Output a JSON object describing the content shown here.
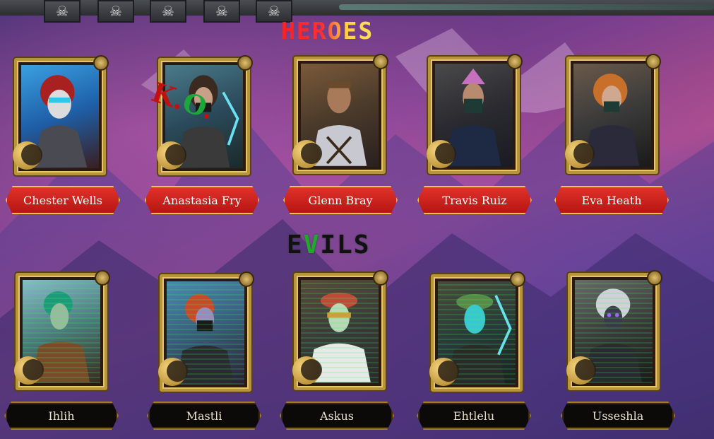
{
  "sections": {
    "heroes_title": "HEROES",
    "evils_title_parts": [
      "E",
      "V",
      "ILS"
    ]
  },
  "heroes": [
    {
      "name": "Chester Wells",
      "status": ""
    },
    {
      "name": "Anastasia Fry",
      "status": "K.O."
    },
    {
      "name": "Glenn Bray",
      "status": ""
    },
    {
      "name": "Travis Ruiz",
      "status": ""
    },
    {
      "name": "Eva Heath",
      "status": ""
    }
  ],
  "ko_parts": [
    "K",
    ".",
    "O",
    "."
  ],
  "evils": [
    {
      "name": "Ihlih"
    },
    {
      "name": "Mastli"
    },
    {
      "name": "Askus"
    },
    {
      "name": "Ehtlelu"
    },
    {
      "name": "Usseshla"
    }
  ],
  "colors": {
    "hero_plate": "#c81e18",
    "plate_border": "#f3c24a",
    "evil_plate": "#0c0a08",
    "card_frame": "#b8943a",
    "ko_red": "#c01010",
    "ko_green": "#1aa838",
    "evil_scanline": "#28ff50"
  },
  "icons": [
    "skull-icon",
    "crescent-moon-icon",
    "gold-badge-icon"
  ]
}
